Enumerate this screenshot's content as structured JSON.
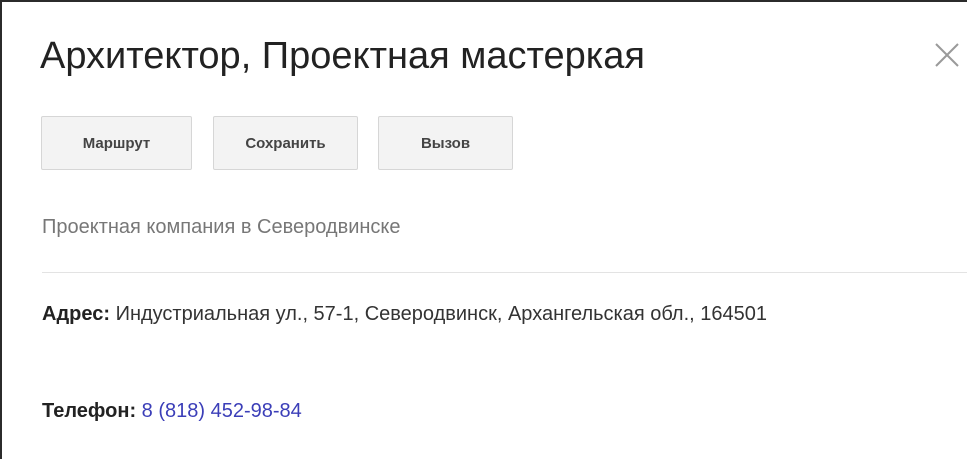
{
  "place": {
    "title": "Архитектор, Проектная мастеркая",
    "category": "Проектная компания в Северодвинске"
  },
  "actions": {
    "route_label": "Маршрут",
    "save_label": "Сохранить",
    "call_label": "Вызов"
  },
  "details": {
    "address_label": "Адрес:",
    "address_value": "Индустриальная ул., 57-1, Северодвинск, Архангельская обл., 164501",
    "phone_label": "Телефон:",
    "phone_value": "8 (818) 452-98-84"
  },
  "icons": {
    "close": "close-icon"
  },
  "colors": {
    "link": "#3b3eb8",
    "button_bg": "#f3f3f3",
    "muted_text": "#777777"
  }
}
